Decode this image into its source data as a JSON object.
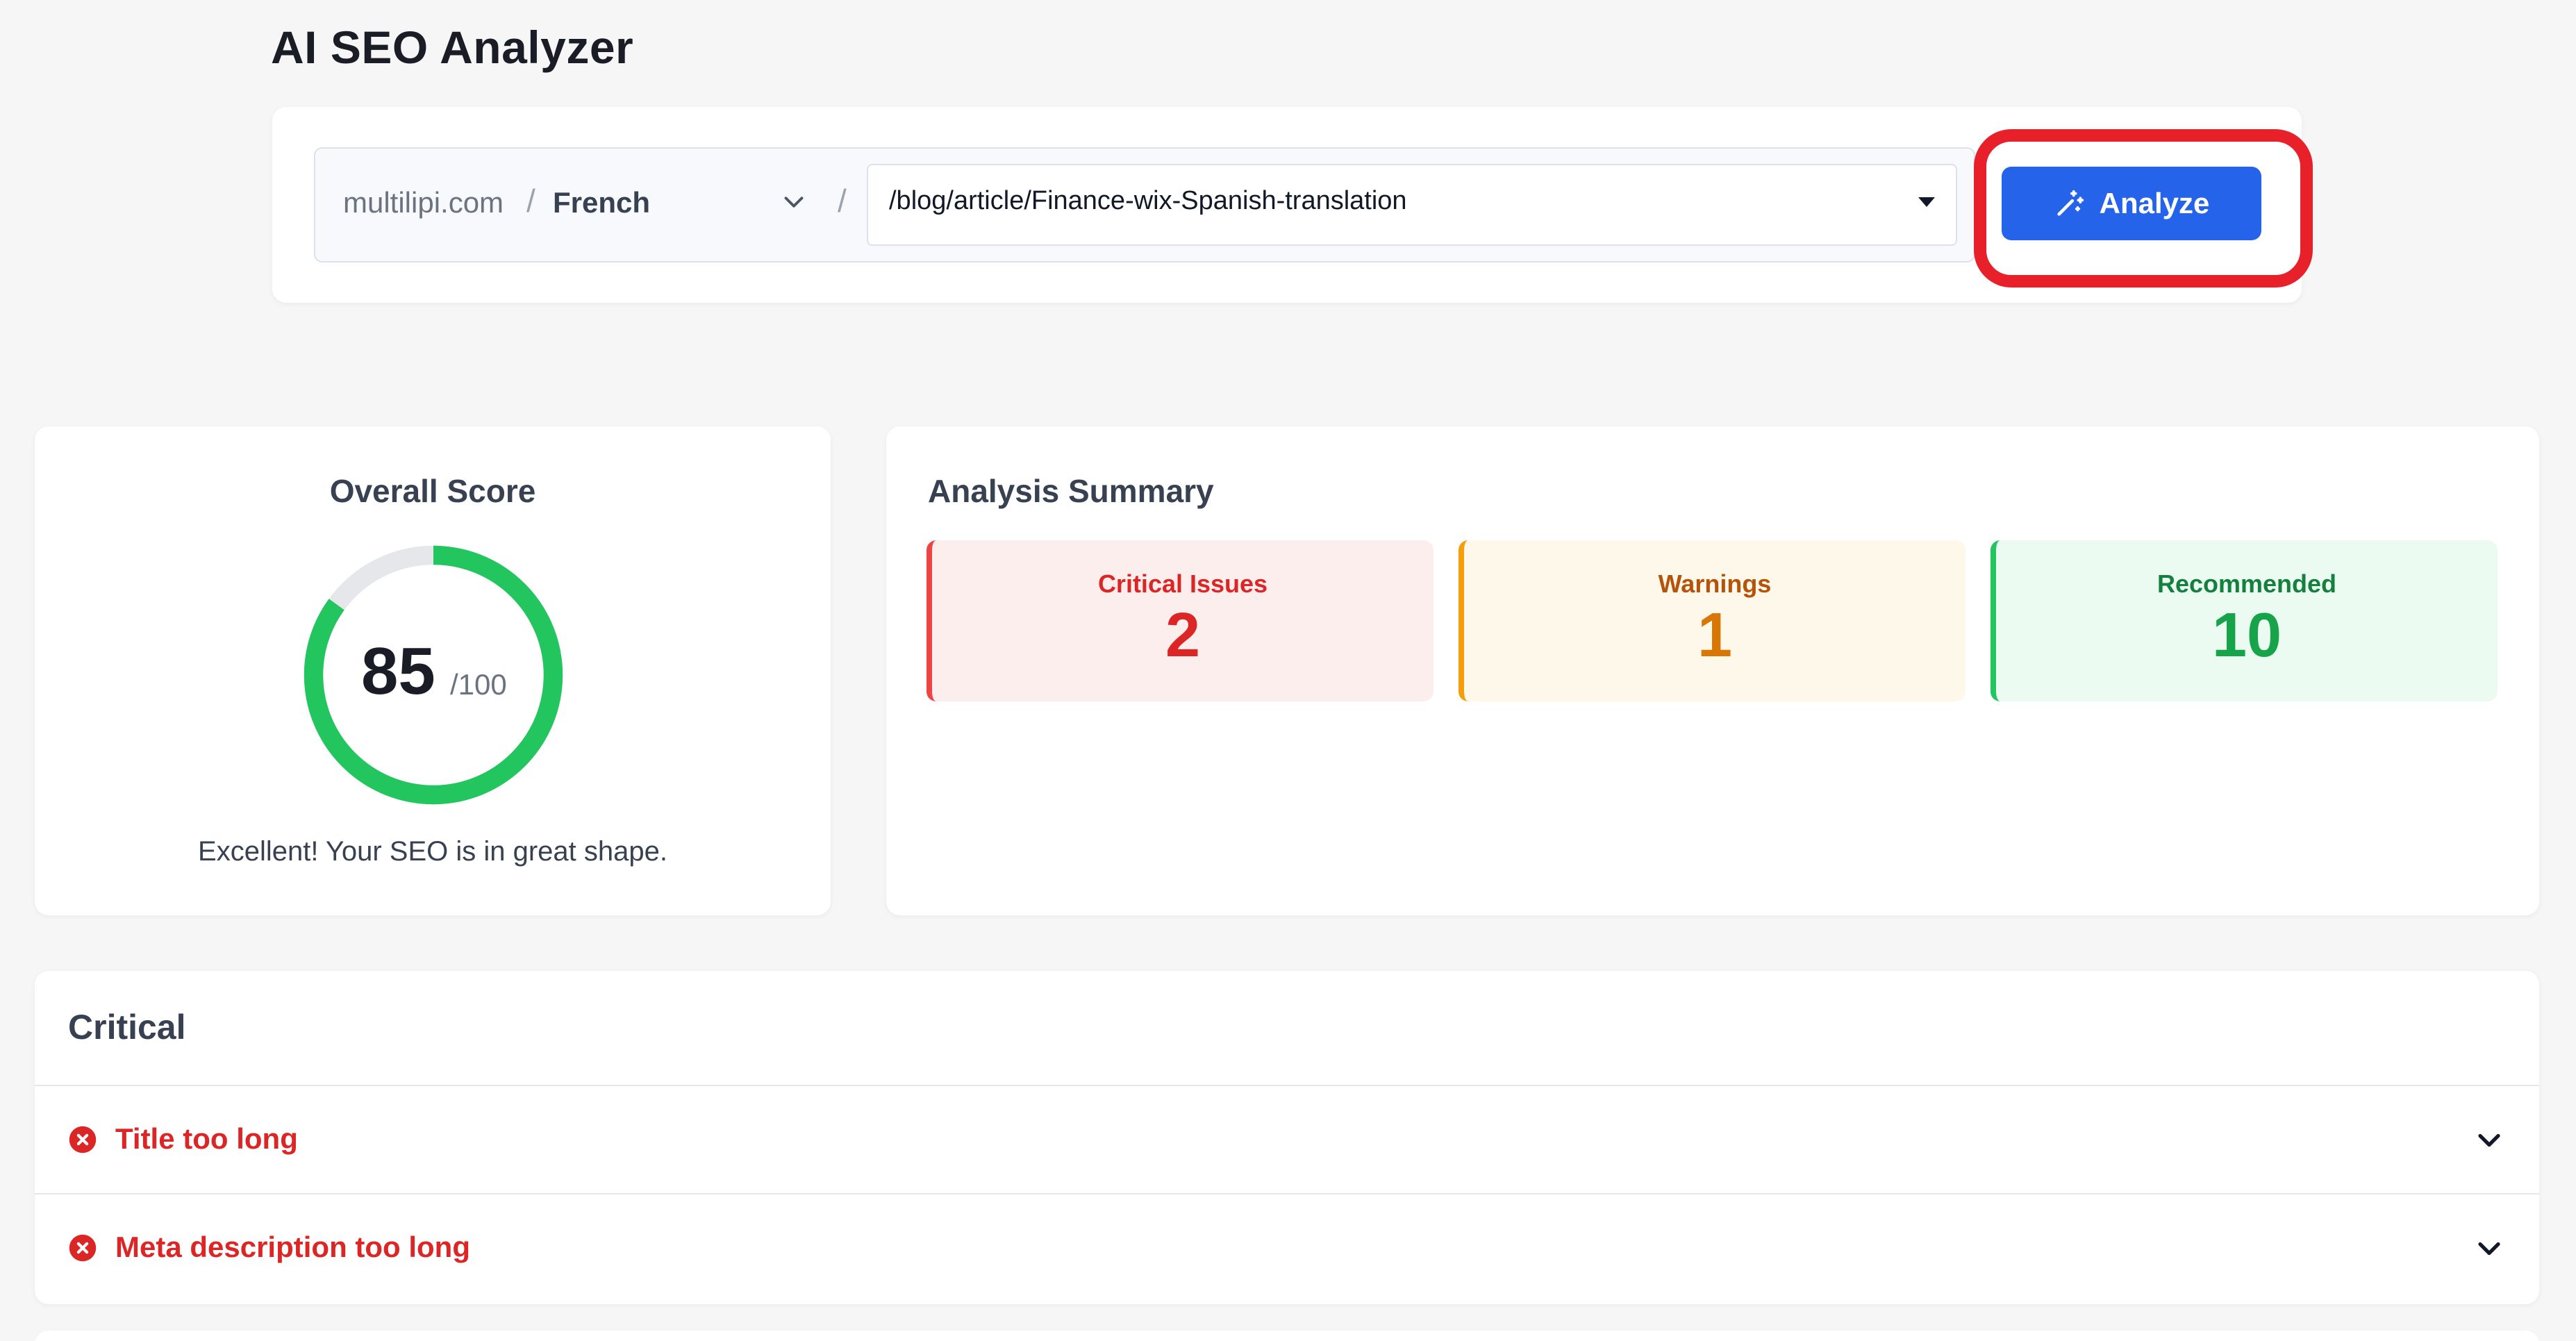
{
  "page": {
    "title": "AI SEO Analyzer"
  },
  "url_bar": {
    "domain": "multilipi.com",
    "separator": "/",
    "language": "French",
    "path": "/blog/article/Finance-wix-Spanish-translation",
    "analyze_label": "Analyze"
  },
  "score": {
    "title": "Overall Score",
    "value": "85",
    "max": "/100",
    "fraction": 0.85,
    "message": "Excellent! Your SEO is in great shape."
  },
  "summary": {
    "title": "Analysis Summary",
    "critical_label": "Critical Issues",
    "critical_value": "2",
    "warnings_label": "Warnings",
    "warnings_value": "1",
    "recommended_label": "Recommended",
    "recommended_value": "10"
  },
  "critical": {
    "title": "Critical",
    "items": [
      {
        "label": "Title too long"
      },
      {
        "label": "Meta description too long"
      }
    ]
  },
  "colors": {
    "primary": "#2563eb",
    "highlight": "#e8202a",
    "score_ring": "#22c55e",
    "critical": "#dc2626",
    "warning": "#d97706",
    "recommended": "#16a34a"
  }
}
